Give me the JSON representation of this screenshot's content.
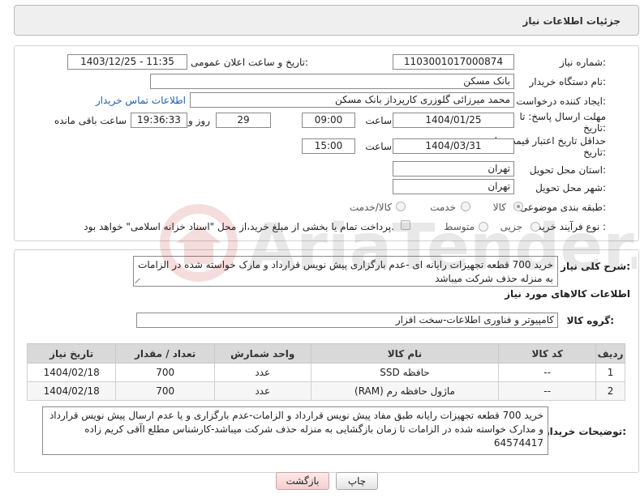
{
  "header": {
    "title": "جزئیات اطلاعات نیاز"
  },
  "form": {
    "need_number_label": "شماره نیاز:",
    "need_number": "1103001017000874",
    "announce_label": "تاریخ و ساعت اعلان عمومی:",
    "announce_value": "1403/12/25 - 11:35",
    "buyer_org_label": "نام دستگاه خریدار:",
    "buyer_org": "بانک مسکن",
    "creator_label": "ایجاد کننده درخواست:",
    "creator": "محمد میرزائی گلوزری کارپرداز بانک مسکن",
    "contact_link": "اطلاعات تماس خریدار",
    "deadline_label_1": "مهلت ارسال پاسخ: تا",
    "deadline_label_2": "تاریخ:",
    "deadline_date": "1404/01/25",
    "time_label": "ساعت",
    "deadline_time": "09:00",
    "days_value": "29",
    "days_label": "روز و",
    "remaining_time": "19:36:33",
    "remaining_label": "ساعت باقی مانده",
    "min_validity_label_1": "حداقل تاریخ اعتبار قیمت: تا",
    "min_validity_label_2": "تاریخ:",
    "validity_date": "1404/03/31",
    "validity_time_label": "ساعت",
    "validity_time": "15:00",
    "province_label": "استان محل تحویل:",
    "province": "تهران",
    "city_label": "شهر محل تحویل:",
    "city": "تهران",
    "category_label": "طبقه بندی موضوعی:",
    "category_options": [
      "کالا",
      "خدمت",
      "کالا/خدمت"
    ],
    "process_label": "نوع فرآیند خرید :",
    "process_options": [
      "جزیی",
      "متوسط"
    ],
    "payment_note": "پرداخت تمام یا بخشی از مبلغ خرید،از محل \"اسناد خزانه اسلامی\" خواهد بود."
  },
  "description": {
    "summary_label": "شرح کلی نیاز:",
    "summary": "خرید 700 قطعه تجهیزات رایانه ای -عدم بارگزاری پیش نویس قرارداد و مارک خواسته شده در الزامات به منزله حذف شرکت میباشد",
    "goods_info_title": "اطلاعات کالاهای مورد نیاز",
    "goods_group_label": "گروه کالا:",
    "goods_group": "کامپیوتر و فناوری اطلاعات-سخت افزار"
  },
  "table": {
    "headers": [
      "ردیف",
      "کد کالا",
      "نام کالا",
      "واحد شمارش",
      "تعداد / مقدار",
      "تاریخ نیاز"
    ],
    "rows": [
      {
        "idx": "1",
        "code": "--",
        "name": "حافظه SSD",
        "unit": "عدد",
        "qty": "700",
        "date": "1404/02/18"
      },
      {
        "idx": "2",
        "code": "--",
        "name": "ماژول حافظه رم (RAM)",
        "unit": "عدد",
        "qty": "700",
        "date": "1404/02/18"
      }
    ]
  },
  "buyer_notes": {
    "label": "توضیحات خریدار:",
    "text": "خرید 700 قطعه تجهیزات رایانه طبق مفاد پیش نویس قرارداد و الزامات-عدم بارگزاری  و یا عدم ارسال پیش نویس قرارداد و مدارک خواسته شده در الزامات تا زمان بازگشایی به منزله حذف شرکت میباشد-کارشناس مطلع اآقی کریم زاده 64574417"
  },
  "buttons": {
    "print": "چاپ",
    "back": "بازگشت"
  },
  "watermark": {
    "text": "AriaTender.neT"
  },
  "colors": {
    "link": "#1b5fb3",
    "header_bg": "#efefef",
    "table_header_bg": "#d9d9d9"
  }
}
